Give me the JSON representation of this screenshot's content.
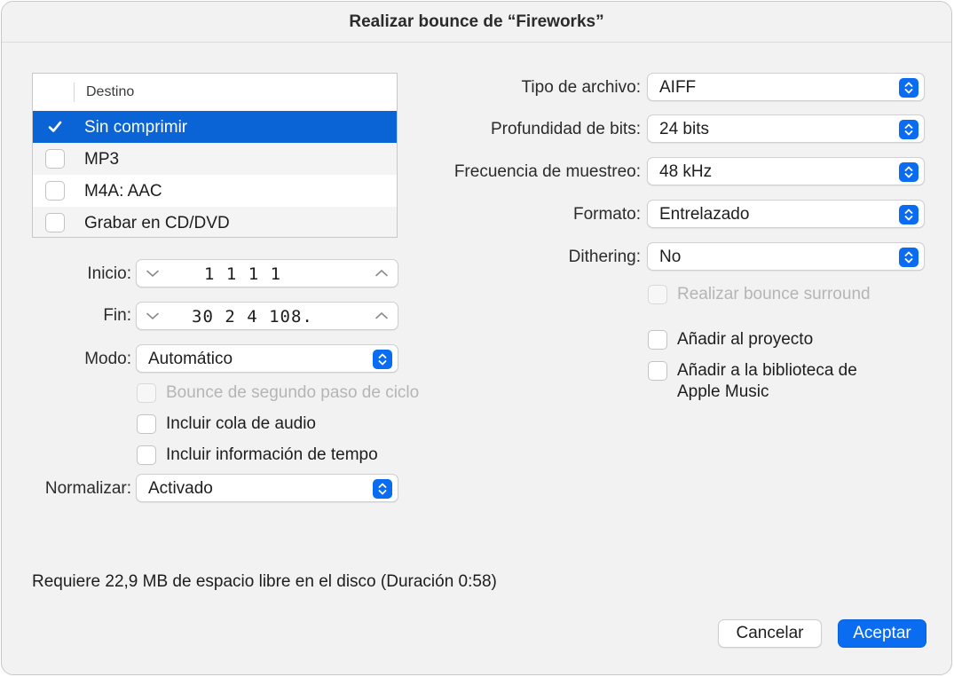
{
  "window": {
    "title": "Realizar bounce de “Fireworks”"
  },
  "destination": {
    "header": "Destino",
    "items": [
      {
        "label": "Sin comprimir",
        "checked": true,
        "selected": true
      },
      {
        "label": "MP3",
        "checked": false
      },
      {
        "label": "M4A: AAC",
        "checked": false
      },
      {
        "label": "Grabar en CD/DVD",
        "checked": false
      }
    ]
  },
  "range": {
    "start_label": "Inicio:",
    "start_value": "1 1 1   1",
    "end_label": "Fin:",
    "end_value": "30 2 4 108."
  },
  "mode": {
    "label": "Modo:",
    "value": "Automático"
  },
  "options_left": {
    "cycle_bounce": "Bounce de segundo paso de ciclo",
    "audio_tail": "Incluir cola de audio",
    "tempo_info": "Incluir información de tempo"
  },
  "normalize": {
    "label": "Normalizar:",
    "value": "Activado"
  },
  "settings": {
    "file_type": {
      "label": "Tipo de archivo:",
      "value": "AIFF"
    },
    "bit_depth": {
      "label": "Profundidad de bits:",
      "value": "24 bits"
    },
    "sample_rate": {
      "label": "Frecuencia de muestreo:",
      "value": "48 kHz"
    },
    "format": {
      "label": "Formato:",
      "value": "Entrelazado"
    },
    "dithering": {
      "label": "Dithering:",
      "value": "No"
    }
  },
  "options_right": {
    "surround": "Realizar bounce surround",
    "add_project": "Añadir al proyecto",
    "add_library": "Añadir a la biblioteca de Apple Music"
  },
  "footer": {
    "info": "Requiere 22,9 MB de espacio libre en el disco (Duración 0:58)",
    "cancel": "Cancelar",
    "ok": "Aceptar"
  },
  "colors": {
    "accent": "#0a6cf0",
    "selection": "#0a64d6"
  }
}
